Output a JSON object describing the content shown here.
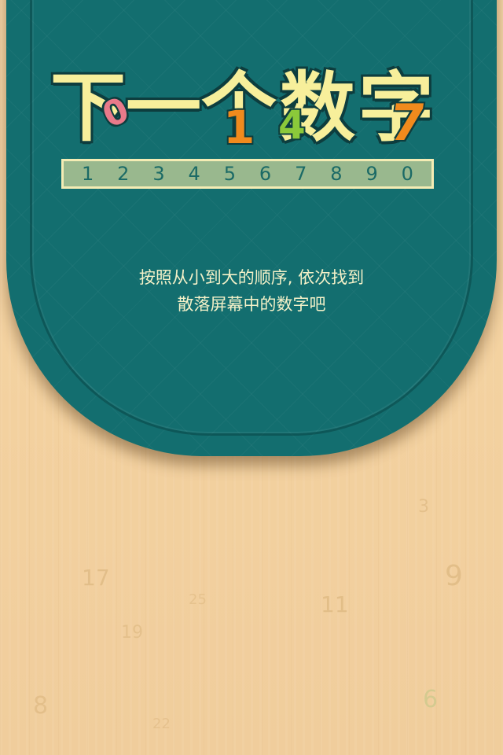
{
  "title": {
    "chars": [
      "下",
      "一",
      "个",
      "数",
      "字"
    ],
    "accent_numbers": [
      {
        "text": "0",
        "color": "#e97a8a"
      },
      {
        "text": "1",
        "color": "#f08a1d"
      },
      {
        "text": "4",
        "color": "#8bc93a"
      },
      {
        "text": "7",
        "color": "#f08a1d"
      }
    ]
  },
  "digit_strip": [
    "1",
    "2",
    "3",
    "4",
    "5",
    "6",
    "7",
    "8",
    "9",
    "0"
  ],
  "instructions": {
    "line1": "按照从小到大的顺序, 依次找到",
    "line2": "散落屏幕中的数字吧"
  },
  "board_numbers": [
    "3",
    "9",
    "17",
    "25",
    "11",
    "19",
    "8",
    "6",
    "22"
  ],
  "colors": {
    "panel": "#136e6f",
    "title_fill": "#f7ef9b",
    "strip_bg": "#99b88e",
    "background": "#f3d19f"
  }
}
